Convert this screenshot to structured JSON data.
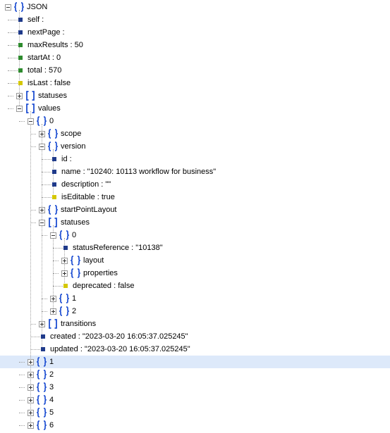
{
  "colors": {
    "bracket": "#1e4fd2",
    "leaf_string": "#1f3a8a",
    "leaf_number": "#2e8b2e",
    "leaf_boolean": "#d4c700",
    "selected_row": "#dde9fa"
  },
  "tree": [
    {
      "depth": 0,
      "kind": "object",
      "state": "expanded",
      "text": "JSON"
    },
    {
      "depth": 1,
      "kind": "leaf",
      "vtype": "string",
      "text": "self :"
    },
    {
      "depth": 1,
      "kind": "leaf",
      "vtype": "string",
      "text": "nextPage :"
    },
    {
      "depth": 1,
      "kind": "leaf",
      "vtype": "number",
      "text": "maxResults : 50"
    },
    {
      "depth": 1,
      "kind": "leaf",
      "vtype": "number",
      "text": "startAt : 0"
    },
    {
      "depth": 1,
      "kind": "leaf",
      "vtype": "number",
      "text": "total : 570"
    },
    {
      "depth": 1,
      "kind": "leaf",
      "vtype": "boolean",
      "text": "isLast : false"
    },
    {
      "depth": 1,
      "kind": "array",
      "state": "collapsed",
      "text": "statuses"
    },
    {
      "depth": 1,
      "kind": "array",
      "state": "expanded",
      "text": "values"
    },
    {
      "depth": 2,
      "kind": "object",
      "state": "expanded",
      "text": "0"
    },
    {
      "depth": 3,
      "kind": "object",
      "state": "collapsed",
      "text": "scope"
    },
    {
      "depth": 3,
      "kind": "object",
      "state": "expanded",
      "text": "version"
    },
    {
      "depth": 4,
      "kind": "leaf",
      "vtype": "string",
      "text": "id :"
    },
    {
      "depth": 4,
      "kind": "leaf",
      "vtype": "string",
      "text": "name : \"10240: 10113 workflow for business\""
    },
    {
      "depth": 4,
      "kind": "leaf",
      "vtype": "string",
      "text": "description : \"\""
    },
    {
      "depth": 4,
      "kind": "leaf",
      "vtype": "boolean",
      "text": "isEditable : true"
    },
    {
      "depth": 3,
      "kind": "object",
      "state": "collapsed",
      "text": "startPointLayout"
    },
    {
      "depth": 3,
      "kind": "array",
      "state": "expanded",
      "text": "statuses"
    },
    {
      "depth": 4,
      "kind": "object",
      "state": "expanded",
      "text": "0"
    },
    {
      "depth": 5,
      "kind": "leaf",
      "vtype": "string",
      "text": "statusReference : \"10138\""
    },
    {
      "depth": 5,
      "kind": "object",
      "state": "collapsed",
      "text": "layout"
    },
    {
      "depth": 5,
      "kind": "object",
      "state": "collapsed",
      "text": "properties"
    },
    {
      "depth": 5,
      "kind": "leaf",
      "vtype": "boolean",
      "text": "deprecated : false"
    },
    {
      "depth": 4,
      "kind": "object",
      "state": "collapsed",
      "text": "1"
    },
    {
      "depth": 4,
      "kind": "object",
      "state": "collapsed",
      "text": "2"
    },
    {
      "depth": 3,
      "kind": "array",
      "state": "collapsed",
      "text": "transitions"
    },
    {
      "depth": 3,
      "kind": "leaf",
      "vtype": "string",
      "text": "created : \"2023-03-20 16:05:37.025245\""
    },
    {
      "depth": 3,
      "kind": "leaf",
      "vtype": "string",
      "text": "updated : \"2023-03-20 16:05:37.025245\""
    },
    {
      "depth": 2,
      "kind": "object",
      "state": "collapsed",
      "selected": true,
      "text": "1"
    },
    {
      "depth": 2,
      "kind": "object",
      "state": "collapsed",
      "text": "2"
    },
    {
      "depth": 2,
      "kind": "object",
      "state": "collapsed",
      "text": "3"
    },
    {
      "depth": 2,
      "kind": "object",
      "state": "collapsed",
      "text": "4"
    },
    {
      "depth": 2,
      "kind": "object",
      "state": "collapsed",
      "text": "5"
    },
    {
      "depth": 2,
      "kind": "object",
      "state": "collapsed",
      "text": "6"
    }
  ]
}
